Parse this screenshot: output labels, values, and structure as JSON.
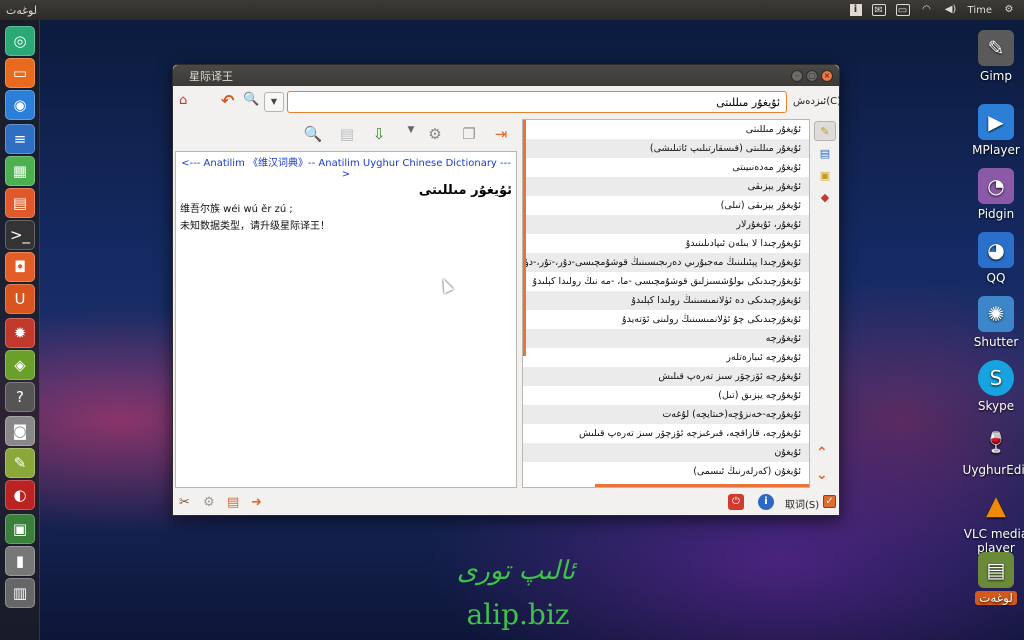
{
  "top_panel": {
    "app_name": "لوغەت",
    "time": "Time"
  },
  "window": {
    "title": "星际译王",
    "search": {
      "value": "ئۇيغۇر مىللىتى",
      "label": "ئىزدەش(C)"
    },
    "result": {
      "header": "<--- Anatilim 《维汉词典》-- Anatilim Uyghur Chinese Dictionary --->",
      "word": "ئۇيغۇر مىللىتى",
      "lines": [
        "维吾尔族 wéi wú ěr zú ;",
        "未知数据类型，请升级星际译王！"
      ]
    },
    "word_list": [
      "ئۇيغۇر مىللىتى",
      "ئۇيغۇر مىللىتى (قىسقارتىلىپ ئاتىلىشى)",
      "ئۇيغۇر مەدەنىيىتى",
      "ئۇيغۇر يېزىقى",
      "ئۇيغۇر يېزىقى (تىلى)",
      "ئۇيغۇر، ئۇيغۇرلار",
      "ئۇيغۇرچىدا لا بىلەن ئىپادىلىنىدۇ",
      "ئۇيغۇرچىدا پېئىلىنىڭ مەجبۇرىي دەرىجىسىنىڭ قوشۇمچىسى-دۇر،-تۇر،-دۈر،-تۈر بىلەن ئىپادىلىنىدۇ",
      "ئۇيغۇرچىدىكى بولۇشسىزلىق قوشۇمچىسى -ما، -مە نىڭ رولىدا كېلىدۇ",
      "ئۇيغۇرچىدىكى دە ئۈلانمىسىنىڭ رولىدا كېلىدۇ",
      "ئۇيغۇرچىدىكى چۇ ئۈلانمىسىنىڭ رولىنى ئۆتەيدۇ",
      "ئۇيغۇرچە",
      "ئۇيغۇرچە ئىبارەتلەر",
      "ئۇيغۇرچە ئۆزچۆر سىز تەرەپ قىلىش",
      "ئۇيغۇرچە يېزىق (تىل)",
      "ئۇيغۇرچە-خەنزۇچە(خىتايچە) لۇغەت",
      "ئۇيغۇرچە، قازاقچە، قىرغىزچە ئۆزچۆر سىز تەرەپ قىلىش",
      "ئۇيغۇن",
      "ئۇيغۇن (كەرلەرنىڭ ئىسمى)"
    ],
    "status": {
      "scan_label": "取词(S)"
    }
  },
  "desktop_icons": [
    {
      "label": "Gimp",
      "icon": "gimp-icon",
      "color": "#5a5a5a"
    },
    {
      "label": "MPlayer",
      "icon": "mplayer-icon",
      "color": "#2b7fd6"
    },
    {
      "label": "Pidgin",
      "icon": "pidgin-icon",
      "color": "#8a5aa8"
    },
    {
      "label": "QQ",
      "icon": "qq-icon",
      "color": "#2a6fc9"
    },
    {
      "label": "Shutter",
      "icon": "shutter-icon",
      "color": "#3c86c9"
    },
    {
      "label": "Skype",
      "icon": "skype-icon",
      "color": "#17a3e0"
    },
    {
      "label": "UyghurEdit",
      "icon": "uyghuredit-icon",
      "color": "#b21f1f"
    },
    {
      "label": "VLC media player",
      "icon": "vlc-icon",
      "color": "#f08a00"
    },
    {
      "label": "لوغەت",
      "icon": "dictionary-icon",
      "color": "#d25a1e"
    }
  ],
  "watermark": {
    "uyghur": "ئالىپ تورى",
    "latin": "alip.biz"
  }
}
